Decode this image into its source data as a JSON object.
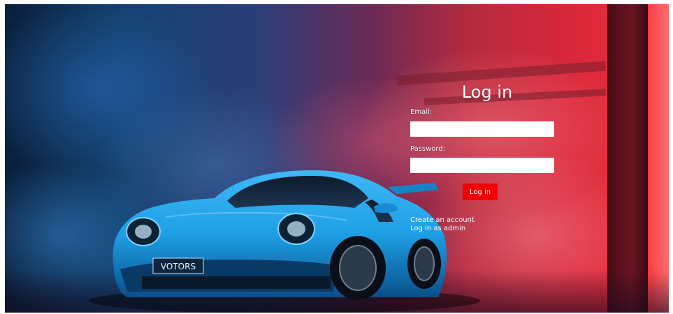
{
  "login": {
    "title": "Log in",
    "email_label": "Email:",
    "email_value": "",
    "password_label": "Password:",
    "password_value": "",
    "submit_label": "Log in",
    "links": {
      "create_account": "Create an account",
      "admin_login": "Log in as admin"
    }
  },
  "car": {
    "plate_text": "VOTORS"
  },
  "colors": {
    "button": "#f00000",
    "car_body": "#1e9fe6",
    "background_left": "#14406e",
    "background_right": "#ee2e38"
  }
}
